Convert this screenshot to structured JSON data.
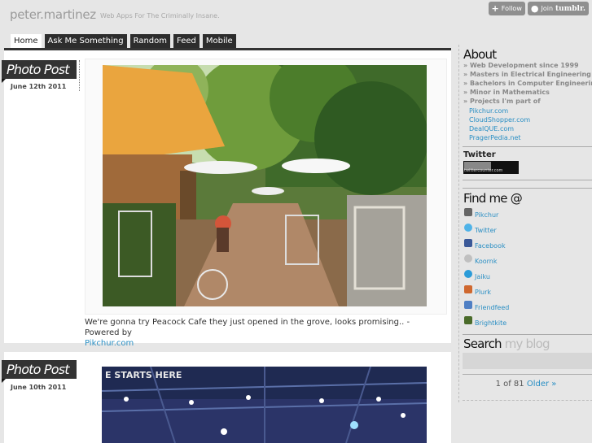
{
  "site": {
    "title": "peter.martinez",
    "tagline": "Web Apps For The Criminally Insane."
  },
  "tumblr_controls": {
    "follow": "Follow",
    "join": "Join",
    "brand": "tumblr."
  },
  "nav": {
    "tabs": [
      "Home",
      "Ask Me Something",
      "Random",
      "Feed",
      "Mobile"
    ],
    "active": "Home"
  },
  "posts": [
    {
      "type_label": "Photo Post",
      "date": "June 12th 2011",
      "caption": "We're gonna try Peacock Cafe they just opened in the grove, looks promising.. - Powered by",
      "caption_link": "Pikchur.com"
    },
    {
      "type_label": "Photo Post",
      "date": "June 10th 2011",
      "photo_sign_text": "E STARTS HERE"
    }
  ],
  "sidebar": {
    "about": {
      "heading": "About",
      "items": [
        "» Web Development since 1999",
        "» Masters in Electrical Engineering",
        "» Bachelors in Computer Engineering",
        "» Minor in Mathematics",
        "» Projects I'm part of"
      ],
      "projects": [
        "Pikchur.com",
        "CloudShopper.com",
        "DealQUE.com",
        "PragerPedia.net"
      ]
    },
    "twitter": {
      "heading": "Twitter",
      "counter_text": "twittercounter.com"
    },
    "find_me": {
      "heading": "Find me @",
      "links": [
        {
          "label": "Pikchur",
          "icon": "camera-icon",
          "color": "#666666"
        },
        {
          "label": "Twitter",
          "icon": "twitter-bird-icon",
          "color": "#4fb3e8"
        },
        {
          "label": "Facebook",
          "icon": "facebook-icon",
          "color": "#3b5998"
        },
        {
          "label": "Koornk",
          "icon": "koornk-icon",
          "color": "#c0c0c0"
        },
        {
          "label": "Jaiku",
          "icon": "jaiku-icon",
          "color": "#2a9bd8"
        },
        {
          "label": "Plurk",
          "icon": "plurk-icon",
          "color": "#cf682f"
        },
        {
          "label": "Friendfeed",
          "icon": "friendfeed-icon",
          "color": "#4f7fc4"
        },
        {
          "label": "Brightkite",
          "icon": "brightkite-icon",
          "color": "#4a6b2a"
        }
      ]
    },
    "search": {
      "heading": "Search",
      "heading_muted": "my blog"
    },
    "pagination": {
      "status": "1 of 81",
      "older": "Older »"
    }
  }
}
